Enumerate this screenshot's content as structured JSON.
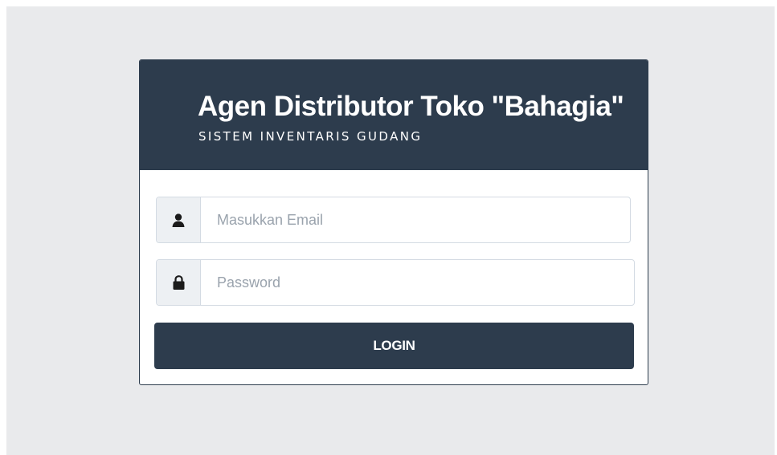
{
  "header": {
    "title": "Agen Distributor Toko \"Bahagia\"",
    "subtitle": "SISTEM INVENTARIS GUDANG"
  },
  "form": {
    "email": {
      "value": "",
      "placeholder": "Masukkan Email",
      "icon": "user-icon"
    },
    "password": {
      "value": "",
      "placeholder": "Password",
      "icon": "lock-icon"
    },
    "login_label": "LOGIN"
  },
  "colors": {
    "primary": "#2d3c4d",
    "page_background": "#e9eaec",
    "addon_background": "#edf0f3",
    "placeholder": "#9aa3ad"
  }
}
